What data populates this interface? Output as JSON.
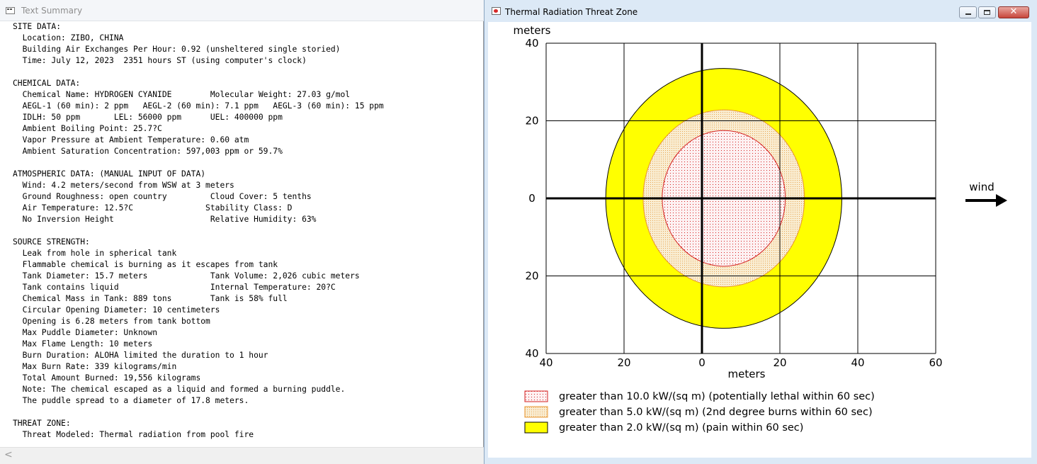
{
  "text_window": {
    "title": "Text Summary",
    "lines": [
      "SITE DATA:",
      "  Location: ZIBO, CHINA",
      "  Building Air Exchanges Per Hour: 0.92 (unsheltered single storied)",
      "  Time: July 12, 2023  2351 hours ST (using computer's clock)",
      "",
      "CHEMICAL DATA:",
      "  Chemical Name: HYDROGEN CYANIDE        Molecular Weight: 27.03 g/mol",
      "  AEGL-1 (60 min): 2 ppm   AEGL-2 (60 min): 7.1 ppm   AEGL-3 (60 min): 15 ppm",
      "  IDLH: 50 ppm       LEL: 56000 ppm      UEL: 400000 ppm",
      "  Ambient Boiling Point: 25.7?C",
      "  Vapor Pressure at Ambient Temperature: 0.60 atm",
      "  Ambient Saturation Concentration: 597,003 ppm or 59.7%",
      "",
      "ATMOSPHERIC DATA: (MANUAL INPUT OF DATA)",
      "  Wind: 4.2 meters/second from WSW at 3 meters",
      "  Ground Roughness: open country         Cloud Cover: 5 tenths",
      "  Air Temperature: 12.5?C               Stability Class: D",
      "  No Inversion Height                    Relative Humidity: 63%",
      "",
      "SOURCE STRENGTH:",
      "  Leak from hole in spherical tank",
      "  Flammable chemical is burning as it escapes from tank",
      "  Tank Diameter: 15.7 meters             Tank Volume: 2,026 cubic meters",
      "  Tank contains liquid                   Internal Temperature: 20?C",
      "  Chemical Mass in Tank: 889 tons        Tank is 58% full",
      "  Circular Opening Diameter: 10 centimeters",
      "  Opening is 6.28 meters from tank bottom",
      "  Max Puddle Diameter: Unknown",
      "  Max Flame Length: 10 meters",
      "  Burn Duration: ALOHA limited the duration to 1 hour",
      "  Max Burn Rate: 339 kilograms/min",
      "  Total Amount Burned: 19,556 kilograms",
      "  Note: The chemical escaped as a liquid and formed a burning puddle.",
      "  The puddle spread to a diameter of 17.8 meters.",
      "",
      "THREAT ZONE:",
      "  Threat Modeled: Thermal radiation from pool fire"
    ],
    "scroll_left_glyph": "<"
  },
  "plot_window": {
    "title": "Thermal Radiation Threat Zone",
    "close_glyph": "✕"
  },
  "chart_data": {
    "type": "threat-zone",
    "xlabel": "meters",
    "ylabel": "meters",
    "xlim": [
      -40,
      60
    ],
    "ylim": [
      -40,
      40
    ],
    "x_ticks": [
      {
        "value": -40,
        "label": "40"
      },
      {
        "value": -20,
        "label": "20"
      },
      {
        "value": 0,
        "label": "0"
      },
      {
        "value": 20,
        "label": "20"
      },
      {
        "value": 40,
        "label": "40"
      },
      {
        "value": 60,
        "label": "60"
      }
    ],
    "y_ticks": [
      {
        "value": 40,
        "label": "40"
      },
      {
        "value": 20,
        "label": "20"
      },
      {
        "value": 0,
        "label": "0"
      },
      {
        "value": -20,
        "label": "20"
      },
      {
        "value": -40,
        "label": "40"
      }
    ],
    "grid": true,
    "wind_label": "wind",
    "zones": [
      {
        "name": "greater than 2.0 kW/(sq m) (pain within 60 sec)",
        "cx": 5.6,
        "cy": 0,
        "rx": 30.3,
        "ry": 33.5,
        "fill": "#ffff00",
        "stroke": "#000000"
      },
      {
        "name": "greater than 5.0 kW/(sq m) (2nd degree burns within 60 sec)",
        "cx": 5.6,
        "cy": 0,
        "rx": 20.7,
        "ry": 22.8,
        "fill": "#f7e9c8",
        "stroke": "#e8952e"
      },
      {
        "name": "greater than 10.0 kW/(sq m) (potentially lethal within 60 sec)",
        "cx": 5.6,
        "cy": 0,
        "rx": 15.8,
        "ry": 17.5,
        "fill": "#fdf1f2",
        "stroke": "#d42020"
      }
    ],
    "legend": [
      {
        "label": "greater than 10.0 kW/(sq m) (potentially lethal within 60 sec)",
        "pattern": "lethal",
        "stroke": "#d42020"
      },
      {
        "label": "greater than 5.0 kW/(sq m) (2nd degree burns within 60 sec)",
        "pattern": "burns",
        "stroke": "#e8952e"
      },
      {
        "label": "greater than 2.0 kW/(sq m) (pain within 60 sec)",
        "pattern": "pain",
        "stroke": "#000000"
      }
    ]
  }
}
